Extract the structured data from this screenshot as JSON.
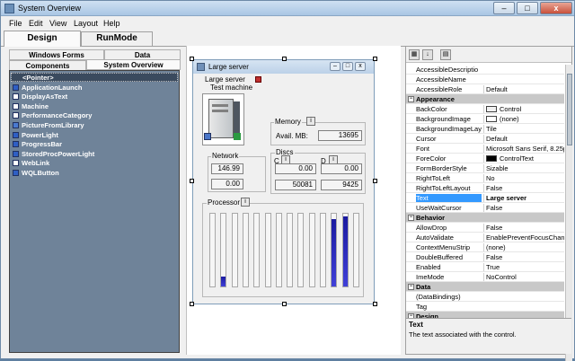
{
  "window": {
    "title": "System Overview",
    "min": "–",
    "max": "□",
    "close": "x"
  },
  "menu": [
    "File",
    "Edit",
    "View",
    "Layout",
    "Help"
  ],
  "modes": [
    "Design",
    "RunMode"
  ],
  "toolbox": {
    "tabs_row1": [
      "Windows Forms",
      "Data"
    ],
    "tabs_row2": [
      "Components",
      "System Overview"
    ],
    "items": [
      "<Pointer>",
      "ApplicationLaunch",
      "DisplayAsText",
      "Machine",
      "PerformanceCategory",
      "PictureFromLibrary",
      "PowerLight",
      "ProgressBar",
      "StoredProcPowerLight",
      "WebLink",
      "WQLButton"
    ],
    "icon_colors": [
      "#c0c0c0",
      "#2f5fc4",
      "#ffffff",
      "#ffffff",
      "#ffffff",
      "#4a7ad0",
      "#2f5fc4",
      "#2f5fc4",
      "#2f5fc4",
      "#ffffff",
      "#2f5fc4"
    ]
  },
  "form": {
    "title": "Large server",
    "machine_label": "Large server",
    "machine_subtitle": "Test machine",
    "memory": {
      "label": "Memory",
      "avail_label": "Avail. MB:",
      "avail_value": "13695"
    },
    "network": {
      "label": "Network",
      "values": [
        "146.99",
        "0.00"
      ]
    },
    "discs": {
      "label": "Discs",
      "c_label": "C",
      "d_label": "D",
      "c_values": [
        "0.00",
        "50081"
      ],
      "d_values": [
        "0.00",
        "9425"
      ]
    },
    "processor": {
      "label": "Processor",
      "levels": [
        0,
        0.14,
        0,
        0,
        0,
        0,
        0,
        0,
        0,
        0,
        0,
        0.92,
        0.96,
        0
      ]
    }
  },
  "properties": {
    "rows": [
      {
        "kind": "prop",
        "name": "AccessibleDescriptio",
        "value": ""
      },
      {
        "kind": "prop",
        "name": "AccessibleName",
        "value": ""
      },
      {
        "kind": "prop",
        "name": "AccessibleRole",
        "value": "Default"
      },
      {
        "kind": "cat",
        "name": "Appearance"
      },
      {
        "kind": "prop",
        "name": "BackColor",
        "value": "Control",
        "swatch": "#f0f0f0"
      },
      {
        "kind": "prop",
        "name": "BackgroundImage",
        "value": "(none)",
        "swatch": "#ffffff"
      },
      {
        "kind": "prop",
        "name": "BackgroundImageLay",
        "value": "Tile"
      },
      {
        "kind": "prop",
        "name": "Cursor",
        "value": "Default"
      },
      {
        "kind": "prop",
        "name": "Font",
        "value": "Microsoft Sans Serif, 8.25p"
      },
      {
        "kind": "prop",
        "name": "ForeColor",
        "value": "ControlText",
        "swatch": "#000000"
      },
      {
        "kind": "prop",
        "name": "FormBorderStyle",
        "value": "Sizable"
      },
      {
        "kind": "prop",
        "name": "RightToLeft",
        "value": "No"
      },
      {
        "kind": "prop",
        "name": "RightToLeftLayout",
        "value": "False"
      },
      {
        "kind": "prop",
        "name": "Text",
        "value": "Large server",
        "selected": true
      },
      {
        "kind": "prop",
        "name": "UseWaitCursor",
        "value": "False"
      },
      {
        "kind": "cat",
        "name": "Behavior"
      },
      {
        "kind": "prop",
        "name": "AllowDrop",
        "value": "False"
      },
      {
        "kind": "prop",
        "name": "AutoValidate",
        "value": "EnablePreventFocusChan"
      },
      {
        "kind": "prop",
        "name": "ContextMenuStrip",
        "value": "(none)"
      },
      {
        "kind": "prop",
        "name": "DoubleBuffered",
        "value": "False"
      },
      {
        "kind": "prop",
        "name": "Enabled",
        "value": "True"
      },
      {
        "kind": "prop",
        "name": "ImeMode",
        "value": "NoControl"
      },
      {
        "kind": "cat",
        "name": "Data"
      },
      {
        "kind": "prop",
        "name": "(DataBindings)",
        "value": ""
      },
      {
        "kind": "prop",
        "name": "Tag",
        "value": ""
      },
      {
        "kind": "cat",
        "name": "Design"
      }
    ],
    "description_title": "Text",
    "description_text": "The text associated with the control."
  }
}
